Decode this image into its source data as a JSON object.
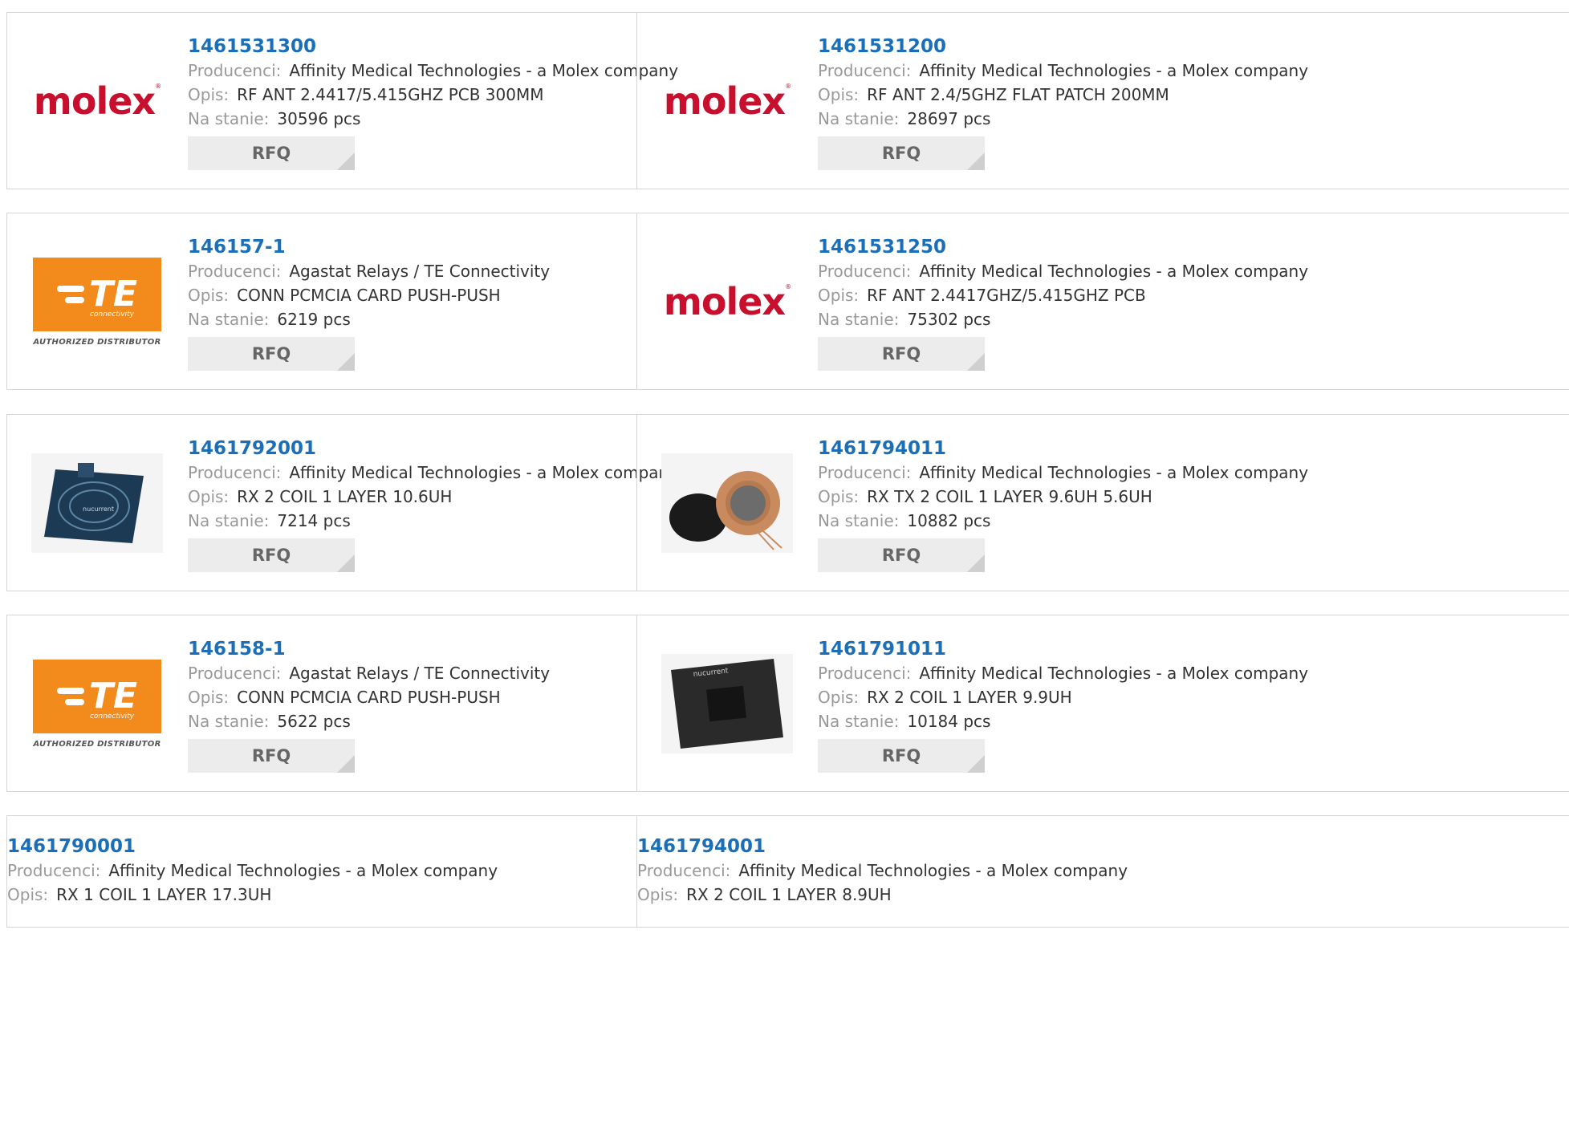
{
  "labels": {
    "manufacturer": "Producenci:",
    "description": "Opis:",
    "stock": "Na stanie:",
    "rfq": "RFQ"
  },
  "products": [
    {
      "part_number": "1461531300",
      "manufacturer": "Affinity Medical Technologies - a Molex company",
      "description": "RF ANT 2.4417/5.415GHZ PCB 300MM",
      "stock": "30596 pcs",
      "image": "molex-logo"
    },
    {
      "part_number": "1461531200",
      "manufacturer": "Affinity Medical Technologies - a Molex company",
      "description": "RF ANT 2.4/5GHZ FLAT PATCH 200MM",
      "stock": "28697 pcs",
      "image": "molex-logo"
    },
    {
      "part_number": "146157-1",
      "manufacturer": "Agastat Relays / TE Connectivity",
      "description": "CONN PCMCIA CARD PUSH-PUSH",
      "stock": "6219 pcs",
      "image": "te-logo"
    },
    {
      "part_number": "1461531250",
      "manufacturer": "Affinity Medical Technologies - a Molex company",
      "description": "RF ANT 2.4417GHZ/5.415GHZ PCB",
      "stock": "75302 pcs",
      "image": "molex-logo"
    },
    {
      "part_number": "1461792001",
      "manufacturer": "Affinity Medical Technologies - a Molex company",
      "description": "RX 2 COIL 1 LAYER 10.6UH",
      "stock": "7214 pcs",
      "image": "nucurrent-board-photo"
    },
    {
      "part_number": "1461794011",
      "manufacturer": "Affinity Medical Technologies - a Molex company",
      "description": "RX TX 2 COIL 1 LAYER 9.6UH 5.6UH",
      "stock": "10882 pcs",
      "image": "coil-photo"
    },
    {
      "part_number": "146158-1",
      "manufacturer": "Agastat Relays / TE Connectivity",
      "description": "CONN PCMCIA CARD PUSH-PUSH",
      "stock": "5622 pcs",
      "image": "te-logo"
    },
    {
      "part_number": "1461791011",
      "manufacturer": "Affinity Medical Technologies - a Molex company",
      "description": "RX 2 COIL 1 LAYER 9.9UH",
      "stock": "10184 pcs",
      "image": "nucurrent-square-photo"
    },
    {
      "part_number": "1461790001",
      "manufacturer": "Affinity Medical Technologies - a Molex company",
      "description": "RX 1 COIL 1 LAYER 17.3UH"
    },
    {
      "part_number": "1461794001",
      "manufacturer": "Affinity Medical Technologies - a Molex company",
      "description": "RX 2 COIL 1 LAYER 8.9UH"
    }
  ],
  "logos": {
    "molex": "molex",
    "te": "TE",
    "te_sub": "connectivity",
    "te_auth": "AUTHORIZED DISTRIBUTOR",
    "nucurrent": "nucurrent"
  }
}
